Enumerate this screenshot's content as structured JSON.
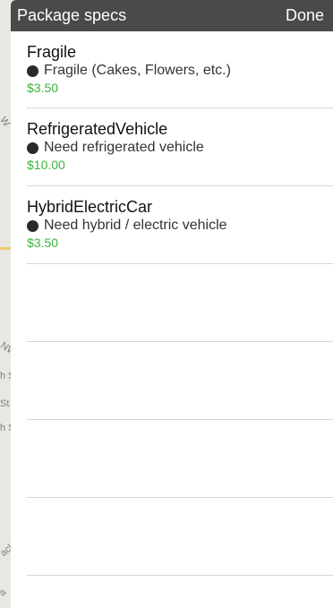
{
  "header": {
    "title": "Package specs",
    "done_label": "Done"
  },
  "items": [
    {
      "title": "Fragile",
      "description": "Fragile (Cakes, Flowers, etc.)",
      "price": "$3.50"
    },
    {
      "title": "RefrigeratedVehicle",
      "description": "Need refrigerated vehicle",
      "price": "$10.00"
    },
    {
      "title": "HybridElectricCar",
      "description": "Need hybrid / electric vehicle",
      "price": "$3.50"
    }
  ],
  "map_labels": [
    "W",
    "NW",
    "h S",
    "St",
    "h S",
    "ack",
    "a"
  ],
  "colors": {
    "header_bg": "#4a4a4a",
    "price": "#3db33d",
    "divider": "#d6d6d6"
  }
}
